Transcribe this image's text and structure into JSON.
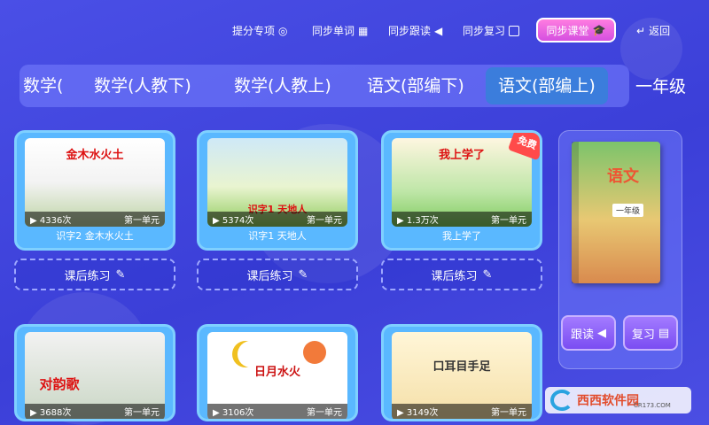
{
  "nav": {
    "back": "返回",
    "sync_class": "同步课堂",
    "sync_review": "同步复习",
    "sync_reading": "同步跟读",
    "sync_words": "同步单词",
    "score_expert": "提分专项"
  },
  "grade": "一年级",
  "tabs": [
    "语文(部编上)",
    "语文(部编下)",
    "数学(人教上)",
    "数学(人教下)",
    "数学("
  ],
  "cards": [
    {
      "heading": "我上学了",
      "unit": "第一单元",
      "views": "1.3万次",
      "title": "我上学了",
      "free": "免费"
    },
    {
      "heading": "识字1 天地人",
      "unit": "第一单元",
      "views": "5374次",
      "title": "识字1 天地人"
    },
    {
      "heading": "金木水火土",
      "unit": "第一单元",
      "views": "4336次",
      "title": "识字2 金木水火土"
    },
    {
      "heading": "口耳目手足",
      "unit": "第一单元",
      "views": "3149次"
    },
    {
      "heading": "日月水火",
      "unit": "第一单元",
      "views": "3106次"
    },
    {
      "heading": "对韵歌",
      "unit": "第一单元",
      "views": "3688次"
    }
  ],
  "exercise_label": "课后练习",
  "book": {
    "title": "语文",
    "grade": "一年级"
  },
  "panel": {
    "review": "复习",
    "reading": "跟读"
  },
  "watermark": {
    "text": "西西软件园",
    "sub": "CR173.COM"
  },
  "colors": {
    "accent": "#3b7ddc",
    "card": "#5ab8ff",
    "active_pill": "#d54fe0"
  }
}
